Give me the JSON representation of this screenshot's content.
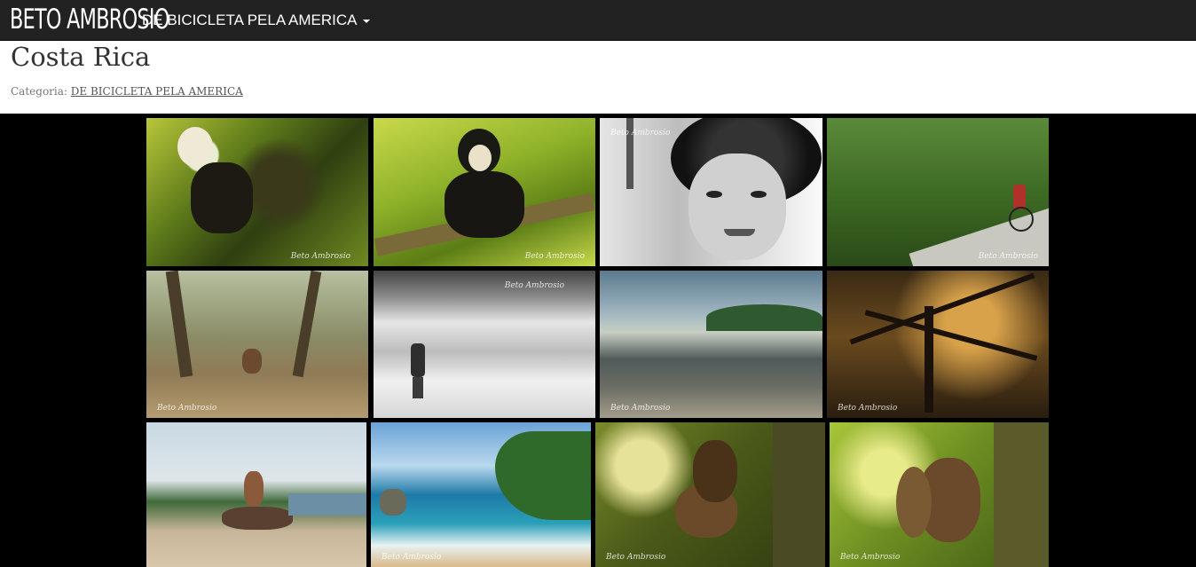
{
  "navbar": {
    "brand": "BETO AMBROSIO",
    "menu_label": "DE BICICLETA PELA AMERICA"
  },
  "page": {
    "title": "Costa Rica",
    "category_prefix": "Categoria:",
    "category_link": "DE BICICLETA PELA AMERICA"
  },
  "watermark": "Beto Ambrosio",
  "gallery": {
    "photos": [
      {
        "name": "photo-monkey-branches",
        "subject": "capuchin monkey in tree branches"
      },
      {
        "name": "photo-monkey-on-branch",
        "subject": "capuchin monkey sitting on branch"
      },
      {
        "name": "photo-child-portrait",
        "subject": "black and white portrait of smiling child"
      },
      {
        "name": "photo-cyclist-forest-road",
        "subject": "cyclist on road through forest"
      },
      {
        "name": "photo-man-beach-palms",
        "subject": "man sitting on beach under palm trees"
      },
      {
        "name": "photo-man-in-surf",
        "subject": "man standing in surf waves"
      },
      {
        "name": "photo-rocky-shore",
        "subject": "rocky shore with stormy sky"
      },
      {
        "name": "photo-twisted-trees",
        "subject": "twisted trees at sunset"
      },
      {
        "name": "photo-man-on-log",
        "subject": "man sitting on log at beach"
      },
      {
        "name": "photo-coastline-aerial",
        "subject": "tropical coastline with turquoise water"
      },
      {
        "name": "photo-squirrel-eating",
        "subject": "squirrel eating on tree trunk"
      },
      {
        "name": "photo-squirrel-climbing",
        "subject": "squirrel climbing tree"
      }
    ]
  }
}
